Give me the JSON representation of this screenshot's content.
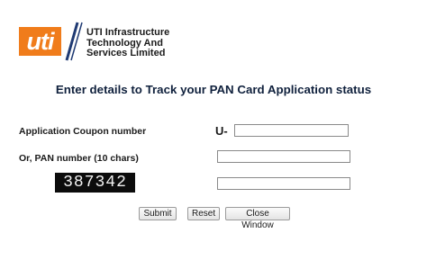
{
  "logo": {
    "text": "uti",
    "accent_color": "#f07c1b",
    "divider_color": "#1f3a73"
  },
  "company": {
    "line1": "UTI Infrastructure",
    "line2": "Technology And",
    "line3": "Services Limited"
  },
  "heading": "Enter details to Track your PAN Card Application status",
  "form": {
    "coupon_label": "Application Coupon number",
    "coupon_prefix": "U-",
    "coupon_value": "",
    "pan_label": "Or, PAN number (10 chars)",
    "pan_value": "",
    "captcha_text": "387342",
    "captcha_value": ""
  },
  "buttons": {
    "submit": "Submit",
    "reset": "Reset",
    "close": "Close Window"
  }
}
